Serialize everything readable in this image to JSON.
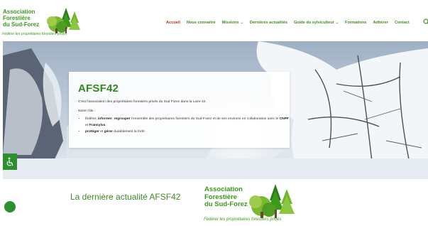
{
  "logo": {
    "line1": "Association",
    "line2": "Forestière",
    "line3": "du Sud-Forez",
    "tagline": "Fédérer les propriétaires forestiers privés"
  },
  "nav": {
    "items": [
      {
        "label": "Accueil",
        "active": true
      },
      {
        "label": "Nous connaitre"
      },
      {
        "label": "Missions",
        "dropdown": true
      },
      {
        "label": "Dernières actualités"
      },
      {
        "label": "Guide du sylviculteur",
        "dropdown": true
      },
      {
        "label": "Formations"
      },
      {
        "label": "Adhérer"
      },
      {
        "label": "Contact"
      }
    ],
    "chevron": "⌄"
  },
  "hero": {
    "title": "AFSF42",
    "intro": "C'est l'association des propriétaires forestiers privés du Sud Forez dans la Loire 42.",
    "role_label": "Notre rôle :",
    "item1": {
      "w1": "fédérer",
      "sep1": ", ",
      "w2": "informer",
      "sep2": ", ",
      "w3": "regrouper",
      "rest": " l'ensemble des propriétaires forestiers du Sud-Forez et de ses environs en collaboration avec le ",
      "org1": "CNPF",
      "and": " et ",
      "org2": "Fransylva"
    },
    "item2": {
      "w1": "protéger",
      "mid": " et ",
      "w2": "gérer",
      "rest": " durablement la forêt"
    }
  },
  "latest": {
    "title": "La dernière actualité AFSF42"
  },
  "colors": {
    "brand_green": "#3a9a1a",
    "active_nav": "#c8260c",
    "accessibility_bg": "#2e8f2f"
  },
  "icons": {
    "search": "search-icon",
    "accessibility": "wheelchair-icon"
  }
}
